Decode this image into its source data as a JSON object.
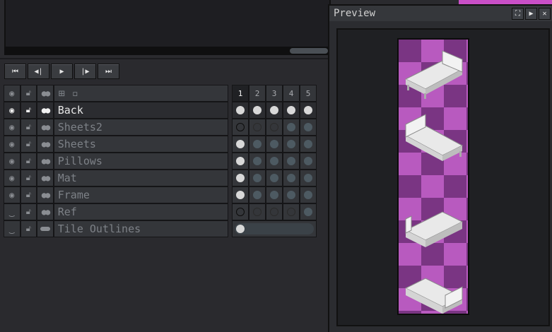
{
  "preview": {
    "title": "Preview",
    "icons": [
      "fullscreen-icon",
      "play-icon",
      "close-icon"
    ]
  },
  "transport": {
    "buttons": [
      "first-frame-icon",
      "previous-frame-icon",
      "play-icon",
      "next-frame-icon",
      "last-frame-icon"
    ]
  },
  "timeline": {
    "frames": [
      "1",
      "2",
      "3",
      "4",
      "5"
    ],
    "current_frame": "1",
    "layers": [
      {
        "name": "Back",
        "active": true,
        "visible": true,
        "cels": [
          "full",
          "full",
          "full",
          "full",
          "full"
        ]
      },
      {
        "name": "Sheets2",
        "active": false,
        "visible": true,
        "cels": [
          "empty",
          "emptyf",
          "emptyf",
          "cont",
          "cont"
        ]
      },
      {
        "name": "Sheets",
        "active": false,
        "visible": true,
        "cels": [
          "full",
          "cont",
          "cont",
          "cont",
          "cont"
        ]
      },
      {
        "name": "Pillows",
        "active": false,
        "visible": true,
        "cels": [
          "full",
          "cont",
          "cont",
          "cont",
          "cont"
        ]
      },
      {
        "name": "Mat",
        "active": false,
        "visible": true,
        "cels": [
          "full",
          "cont",
          "cont",
          "cont",
          "cont"
        ]
      },
      {
        "name": "Frame",
        "active": false,
        "visible": true,
        "cels": [
          "full",
          "cont",
          "cont",
          "cont",
          "cont"
        ]
      },
      {
        "name": "Ref",
        "active": false,
        "visible": false,
        "cels": [
          "empty",
          "emptyf",
          "emptyf",
          "emptyf",
          "cont"
        ]
      },
      {
        "name": "Tile Outlines",
        "active": false,
        "visible": false,
        "cels": "linked"
      }
    ]
  },
  "colors": {
    "checker_light": "#b85abf",
    "checker_dark": "#7a3583",
    "accent_pink": "#c94fc7"
  }
}
